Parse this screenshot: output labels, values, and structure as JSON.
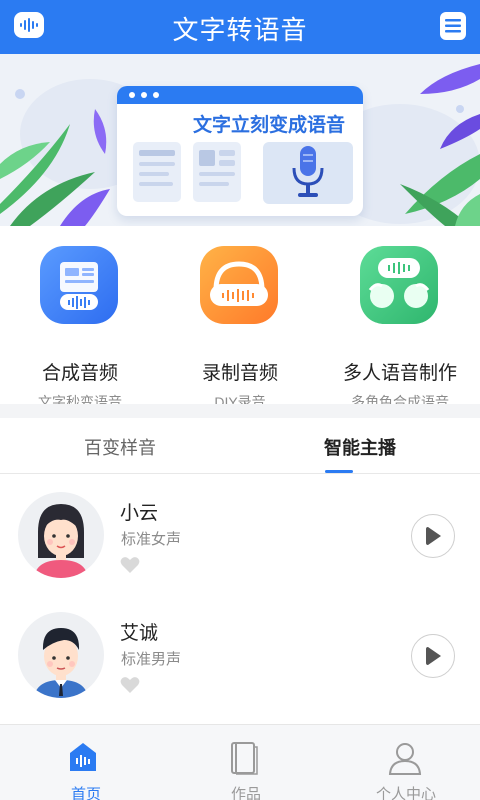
{
  "header": {
    "title": "文字转语音",
    "logo_icon": "voice-wave-icon",
    "menu_icon": "list-menu-icon"
  },
  "banner": {
    "slogan": "文字立刻变成语音",
    "icon": "microphone-icon"
  },
  "features": [
    {
      "name": "合成音频",
      "desc": "文字秒变语音",
      "icon": "document-wave-icon",
      "color": "#3a7ff5"
    },
    {
      "name": "录制音频",
      "desc": "DIY录音",
      "icon": "headphones-icon",
      "color": "#ff8a33"
    },
    {
      "name": "多人语音制作",
      "desc": "多角色合成语音",
      "icon": "chat-bubbles-icon",
      "color": "#3cc47c"
    }
  ],
  "tabs": [
    {
      "label": "百变样音",
      "active": false
    },
    {
      "label": "智能主播",
      "active": true
    }
  ],
  "voices": [
    {
      "name": "小云",
      "desc": "标准女声",
      "avatar": "female-avatar-icon"
    },
    {
      "name": "艾诚",
      "desc": "标准男声",
      "avatar": "male-avatar-icon"
    }
  ],
  "nav": [
    {
      "label": "首页",
      "icon": "home-wave-icon",
      "active": true
    },
    {
      "label": "作品",
      "icon": "book-icon",
      "active": false
    },
    {
      "label": "个人中心",
      "icon": "person-icon",
      "active": false
    }
  ],
  "colors": {
    "primary": "#2b7bf2",
    "text": "#222222",
    "muted": "#8b8b8b"
  }
}
